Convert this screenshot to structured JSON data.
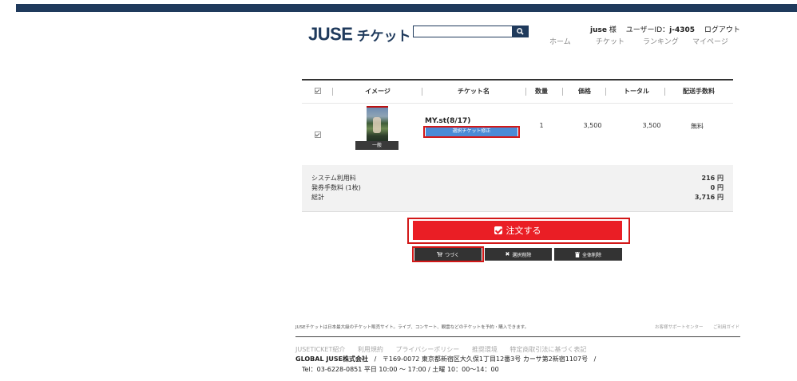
{
  "header": {
    "logo_main": "JUSE",
    "logo_kana": "チケット",
    "search": {
      "value": "",
      "placeholder": ""
    },
    "user": {
      "name": "juse",
      "honorific": "様",
      "id_label": "ユーザーID：",
      "id_value": "j-4305",
      "logout": "ログアウト"
    },
    "nav": [
      "ホーム",
      "チケット",
      "ランキング",
      "マイページ"
    ]
  },
  "cart": {
    "columns": [
      "イメージ",
      "チケット名",
      "数量",
      "価格",
      "トータル",
      "配送手数料"
    ],
    "items": [
      {
        "thumb_label": "一般",
        "name": "MY.st(8/17)",
        "modify_label": "選択チケット修正",
        "quantity": "1",
        "price": "3,500",
        "total": "3,500",
        "shipping": "無料"
      }
    ]
  },
  "summary": {
    "system_fee_label": "システム利用料",
    "system_fee_value": "216 円",
    "issue_fee_label": "発券手数料 (1枚)",
    "issue_fee_value": "0 円",
    "total_label": "総計",
    "total_value": "3,716 円"
  },
  "actions": {
    "order": "注文する",
    "continue": "つづく",
    "delete_selected": "選択削除",
    "delete_all": "全体削除"
  },
  "footer": {
    "description": "JUSEチケットは日本最大級のチケット販売サイト。ライブ、コンサート、観雲などのチケットを予約・購入できます。",
    "support": "お客様サポートセンター",
    "guide": "ご利用ガイド",
    "links": [
      "JUSETICKET紹介",
      "利用規約",
      "プライバシーポリシー",
      "推奨環境",
      "特定商取引法に基づく表記"
    ],
    "company": "GLOBAL JUSE株式会社",
    "address": "〒169-0072 東京都新宿区大久保1丁目12番3号 カーサ第2新宿1107号",
    "tel": "Tel：03-6228-0851 平日 10:00 ～ 17:00 / 土曜 10：00～14：00"
  },
  "colors": {
    "brand": "#1f3a5c",
    "order": "#ea1e25",
    "modify": "#4b8bd6",
    "highlight": "#d21818"
  }
}
